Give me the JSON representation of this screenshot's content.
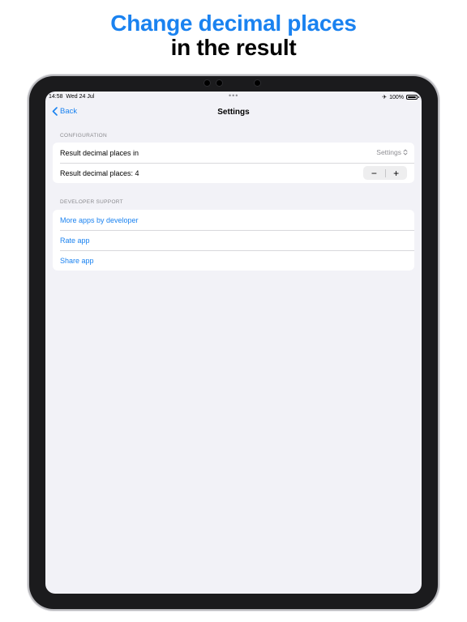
{
  "headline": {
    "line1": "Change decimal places",
    "line2": "in the result"
  },
  "status_bar": {
    "time": "14:58",
    "date": "Wed 24 Jul",
    "battery": "100%",
    "battery_level": 1.0
  },
  "nav": {
    "back_label": "Back",
    "title": "Settings"
  },
  "sections": {
    "configuration": {
      "header": "CONFIGURATION",
      "decimal_places_in_label": "Result decimal places in",
      "decimal_places_in_value": "Settings",
      "decimal_places_label": "Result decimal places: 4",
      "decimal_places_value": 4,
      "stepper_minus": "−",
      "stepper_plus": "+"
    },
    "developer_support": {
      "header": "DEVELOPER SUPPORT",
      "items": [
        "More apps by developer",
        "Rate app",
        "Share app"
      ]
    }
  },
  "colors": {
    "accent": "#1a82f0",
    "background": "#f2f2f7",
    "secondary_text": "#8e8e93"
  }
}
